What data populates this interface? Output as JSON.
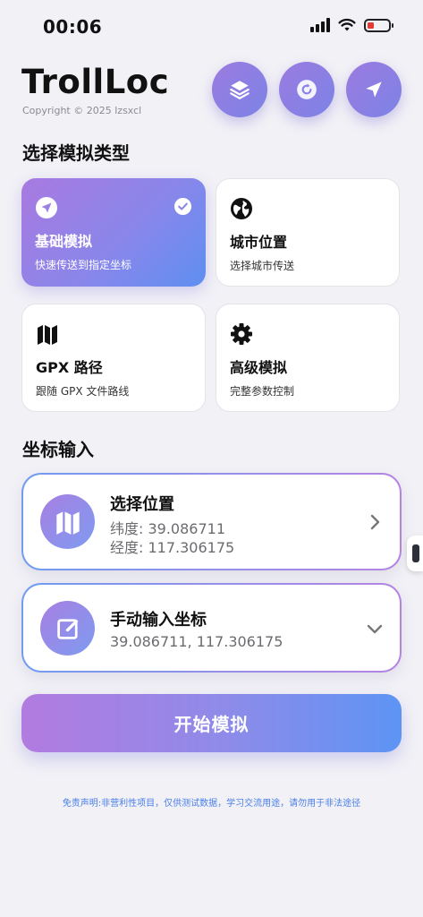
{
  "status": {
    "time": "00:06",
    "battery_level": 0.3
  },
  "header": {
    "title": "TrollLoc",
    "copyright": "Copyright © 2025 lzsxcl",
    "buttons": [
      {
        "icon": "layers-icon"
      },
      {
        "icon": "refresh-icon"
      },
      {
        "icon": "navigation-arrow-icon"
      }
    ]
  },
  "mode_section": {
    "title": "选择模拟类型",
    "cards": [
      {
        "title": "基础模拟",
        "subtitle": "快速传送到指定坐标",
        "icon": "location-arrow-icon",
        "selected": true
      },
      {
        "title": "城市位置",
        "subtitle": "选择城市传送",
        "icon": "globe-icon",
        "selected": false
      },
      {
        "title": "GPX 路径",
        "subtitle": "跟随 GPX 文件路线",
        "icon": "map-icon",
        "selected": false
      },
      {
        "title": "高级模拟",
        "subtitle": "完整参数控制",
        "icon": "gear-icon",
        "selected": false
      }
    ]
  },
  "coord_section": {
    "title": "坐标输入",
    "select_location": {
      "title": "选择位置",
      "latitude_line": "纬度: 39.086711",
      "longitude_line": "经度: 117.306175",
      "icon": "map-icon"
    },
    "manual_input": {
      "title": "手动输入坐标",
      "value": "39.086711, 117.306175",
      "icon": "edit-icon"
    }
  },
  "start_button": {
    "label": "开始模拟"
  },
  "disclaimer": "免责声明:非营利性项目，仅供测试数据，学习交流用途，请勿用于非法途径",
  "colors": {
    "accent_purple": "#a97ae0",
    "accent_blue": "#5e8ff1",
    "background": "#f2f1f6",
    "disclaimer_blue": "#4a7fe8"
  }
}
